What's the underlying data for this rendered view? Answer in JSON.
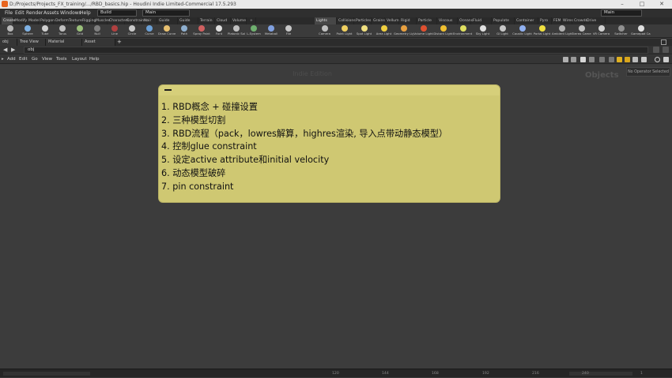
{
  "window": {
    "title": "D:/Projects/Projects_FX_training/.../RBD_basics.hip - Houdini Indie Limited-Commercial 17.5.293",
    "controls": [
      "–",
      "□",
      "✕"
    ]
  },
  "menubar": {
    "items": [
      "File",
      "Edit",
      "Render",
      "Assets",
      "Windows",
      "Help"
    ],
    "desktop_label": "Build",
    "context_label": "Main",
    "right_desktop_label": "Main"
  },
  "shelf": {
    "left_tabs": [
      "Create",
      "Modify",
      "Model",
      "Polygon",
      "Deform",
      "Texture",
      "Rigging",
      "Muscles",
      "Characters",
      "Constraints",
      "Hair Utils",
      "Guide Process",
      "Guide Brushes",
      "Terrain FX",
      "Cloud FX",
      "Volume"
    ],
    "right_tabs": [
      "Lights and C...",
      "Collisions",
      "Particles",
      "Grains",
      "Vellum",
      "Rigid Bodies",
      "Particle Fluids",
      "Viscous Fluids",
      "Oceans",
      "Fluid Contai...",
      "Populate Con...",
      "Container Tools",
      "Pyro FX",
      "FEM",
      "Wires",
      "Crowds",
      "Drive Simula..."
    ],
    "left_tools": [
      {
        "label": "Box",
        "icon": "box-icon"
      },
      {
        "label": "Sphere",
        "icon": "sphere-icon"
      },
      {
        "label": "Tube",
        "icon": "tube-icon"
      },
      {
        "label": "Torus",
        "icon": "torus-icon"
      },
      {
        "label": "Grid",
        "icon": "grid-icon"
      },
      {
        "label": "Null",
        "icon": "null-icon"
      },
      {
        "label": "Line",
        "icon": "line-icon"
      },
      {
        "label": "Circle",
        "icon": "circle-icon"
      },
      {
        "label": "Curve",
        "icon": "curve-icon"
      },
      {
        "label": "Draw Curve",
        "icon": "draw-curve-icon"
      },
      {
        "label": "Path",
        "icon": "path-icon"
      },
      {
        "label": "Spray Paint",
        "icon": "spray-paint-icon"
      },
      {
        "label": "Font",
        "icon": "font-icon"
      },
      {
        "label": "Platonic Solids",
        "icon": "platonic-icon"
      },
      {
        "label": "L-System",
        "icon": "lsystem-icon"
      },
      {
        "label": "Metaball",
        "icon": "metaball-icon"
      },
      {
        "label": "File",
        "icon": "file-icon"
      }
    ],
    "right_tools": [
      {
        "label": "Camera",
        "icon": "camera-icon"
      },
      {
        "label": "Point Light",
        "icon": "point-light-icon"
      },
      {
        "label": "Spot Light",
        "icon": "spot-light-icon"
      },
      {
        "label": "Area Light",
        "icon": "area-light-icon"
      },
      {
        "label": "Geometry Light",
        "icon": "geometry-light-icon"
      },
      {
        "label": "Volume Light",
        "icon": "volume-light-icon"
      },
      {
        "label": "Distant Light",
        "icon": "distant-light-icon"
      },
      {
        "label": "Environment Light",
        "icon": "environment-light-icon"
      },
      {
        "label": "Sky Light",
        "icon": "sky-light-icon"
      },
      {
        "label": "GI Light",
        "icon": "gi-light-icon"
      },
      {
        "label": "Caustic Light",
        "icon": "caustic-light-icon"
      },
      {
        "label": "Portal Light",
        "icon": "portal-light-icon"
      },
      {
        "label": "Ambient Light",
        "icon": "ambient-light-icon"
      },
      {
        "label": "Stereo Camera",
        "icon": "stereo-camera-icon"
      },
      {
        "label": "VR Camera",
        "icon": "vr-camera-icon"
      },
      {
        "label": "Switcher",
        "icon": "switcher-icon"
      },
      {
        "label": "Gamepad Camera",
        "icon": "gamepad-camera-icon"
      }
    ]
  },
  "pane_tabs": [
    "obj",
    "Tree View",
    "Material Palette",
    "Asset Browser"
  ],
  "path": "obj",
  "network_menu": [
    "Add",
    "Edit",
    "Go",
    "View",
    "Tools",
    "Layout",
    "Help"
  ],
  "network": {
    "watermark": "Indie Edition",
    "context_label": "Objects",
    "no_operator_text": "No Operator Selected"
  },
  "sticky_note": {
    "lines": [
      "1. RBD概念 + 碰撞设置",
      "2. 三种模型切割",
      "3. RBD流程（pack，lowres解算，highres渲染, 导入点带动静态模型）",
      "4. 控制glue constraint",
      "5. 设定active attribute和initial velocity",
      "6. 动态模型破碎",
      "7. pin constraint"
    ]
  },
  "timeline": {
    "ticks": [
      "120",
      "144",
      "168",
      "192",
      "216",
      "240",
      "1"
    ]
  },
  "colors": {
    "sticky_bg": "#cfc872",
    "houdini_orange": "#e8651f",
    "canvas": "#3c3c3c"
  }
}
